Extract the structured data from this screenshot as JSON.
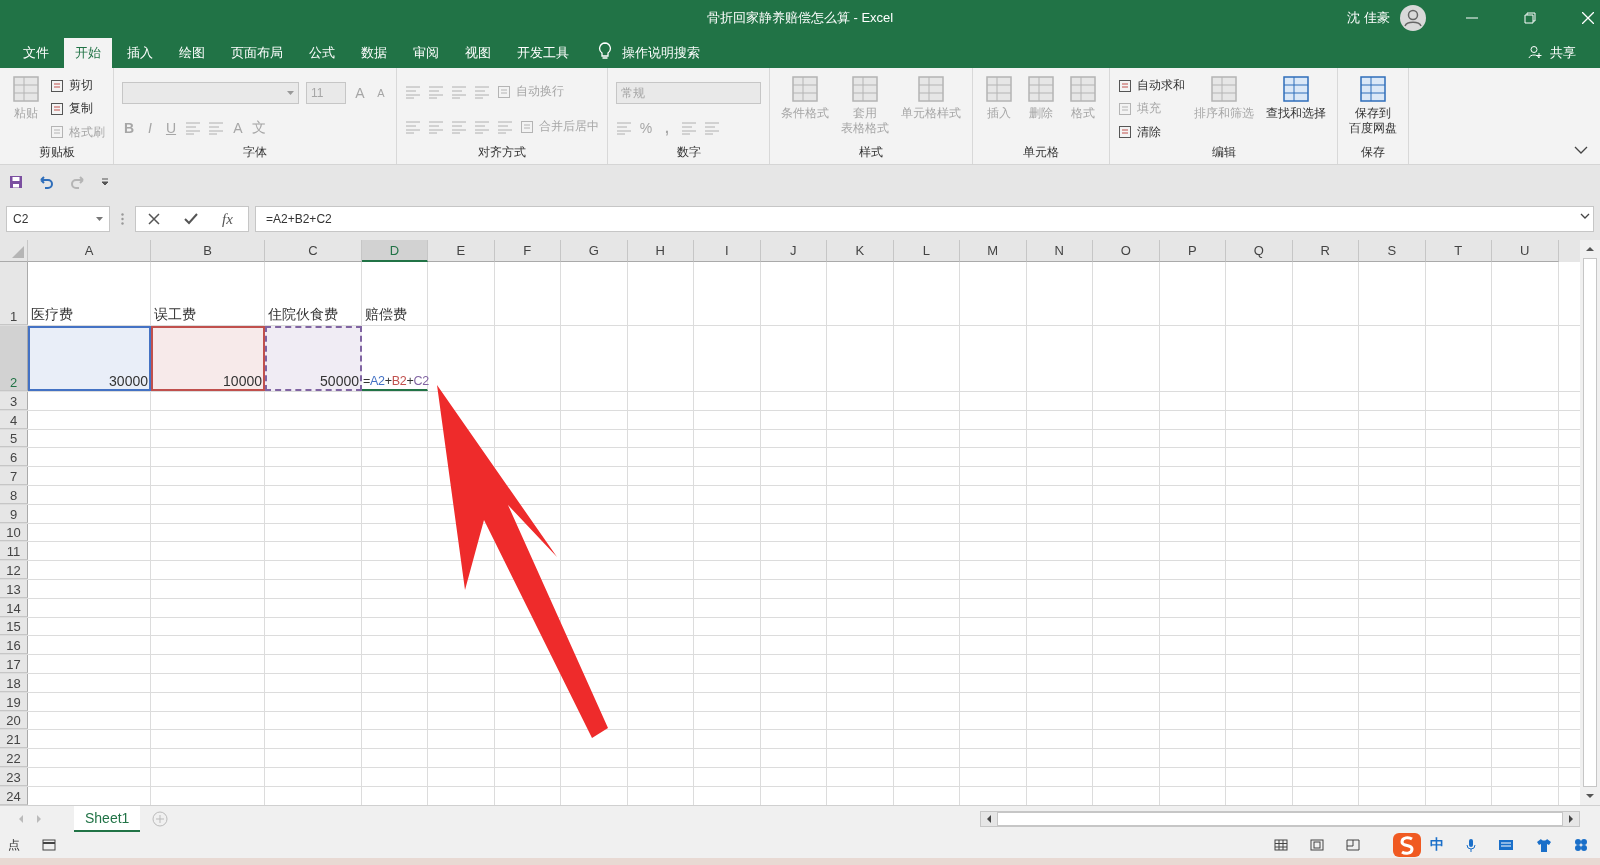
{
  "window": {
    "title": "骨折回家静养赔偿怎么算  -  Excel",
    "user": "沈 佳豪"
  },
  "menu": {
    "tabs": [
      {
        "label": "文件",
        "selected": false
      },
      {
        "label": "开始",
        "selected": true
      },
      {
        "label": "插入",
        "selected": false
      },
      {
        "label": "绘图",
        "selected": false
      },
      {
        "label": "页面布局",
        "selected": false
      },
      {
        "label": "公式",
        "selected": false
      },
      {
        "label": "数据",
        "selected": false
      },
      {
        "label": "审阅",
        "selected": false
      },
      {
        "label": "视图",
        "selected": false
      },
      {
        "label": "开发工具",
        "selected": false
      }
    ],
    "tell_me": "操作说明搜索",
    "share": "共享"
  },
  "ribbon": {
    "groups": [
      {
        "label": "剪贴板",
        "columns": [
          {
            "kind": "large",
            "lines": [
              "粘贴"
            ],
            "disabled": true
          },
          {
            "kind": "tools",
            "rows": [
              [
                {
                  "kind": "labeled",
                  "label": "剪切",
                  "disabled": false
                }
              ],
              [
                {
                  "kind": "labeled",
                  "label": "复制",
                  "disabled": false
                }
              ],
              [
                {
                  "kind": "labeled",
                  "label": "格式刷",
                  "disabled": true
                }
              ]
            ]
          }
        ]
      },
      {
        "label": "字体",
        "columns": [
          {
            "kind": "tools",
            "rows": [
              [
                {
                  "kind": "font-name",
                  "disabled": true
                },
                {
                  "kind": "font-size",
                  "text": "11",
                  "disabled": true
                },
                {
                  "kind": "glyph",
                  "text": "A",
                  "disabled": true
                },
                {
                  "kind": "small",
                  "text": "A",
                  "disabled": true
                }
              ],
              [
                {
                  "kind": "bold",
                  "text": "B",
                  "disabled": true
                },
                {
                  "kind": "italic",
                  "text": "I",
                  "disabled": true
                },
                {
                  "kind": "underline",
                  "text": "U",
                  "disabled": true
                },
                {
                  "kind": "icon",
                  "disabled": true
                },
                {
                  "kind": "icon",
                  "disabled": true
                },
                {
                  "kind": "glyph",
                  "text": "A",
                  "disabled": true
                },
                {
                  "kind": "glyph",
                  "text": "文",
                  "disabled": true
                }
              ]
            ]
          }
        ]
      },
      {
        "label": "对齐方式",
        "columns": [
          {
            "kind": "tools",
            "rows": [
              [
                {
                  "kind": "icon",
                  "disabled": true
                },
                {
                  "kind": "icon",
                  "disabled": true
                },
                {
                  "kind": "icon",
                  "disabled": true
                },
                {
                  "kind": "icon",
                  "disabled": true
                },
                {
                  "kind": "labeled",
                  "label": "自动换行",
                  "disabled": true
                }
              ],
              [
                {
                  "kind": "icon",
                  "disabled": true
                },
                {
                  "kind": "icon",
                  "disabled": true
                },
                {
                  "kind": "icon",
                  "disabled": true
                },
                {
                  "kind": "icon",
                  "disabled": true
                },
                {
                  "kind": "icon",
                  "disabled": true
                },
                {
                  "kind": "labeled",
                  "label": "合并后居中",
                  "disabled": true
                }
              ]
            ]
          }
        ]
      },
      {
        "label": "数字",
        "columns": [
          {
            "kind": "tools",
            "rows": [
              [
                {
                  "kind": "format",
                  "text": "常规",
                  "disabled": true
                }
              ],
              [
                {
                  "kind": "icon",
                  "disabled": true
                },
                {
                  "kind": "glyph",
                  "text": "%",
                  "disabled": true
                },
                {
                  "kind": "bold",
                  "text": ",",
                  "disabled": true
                },
                {
                  "kind": "icon",
                  "disabled": true
                },
                {
                  "kind": "icon",
                  "disabled": true
                }
              ]
            ]
          }
        ]
      },
      {
        "label": "样式",
        "columns": [
          {
            "kind": "large",
            "lines": [
              "条件格式"
            ],
            "disabled": true
          },
          {
            "kind": "large",
            "lines": [
              "套用",
              "表格格式"
            ],
            "disabled": true
          },
          {
            "kind": "large",
            "lines": [
              "单元格样式"
            ],
            "disabled": true
          }
        ]
      },
      {
        "label": "单元格",
        "columns": [
          {
            "kind": "large",
            "lines": [
              "插入"
            ],
            "disabled": true
          },
          {
            "kind": "large",
            "lines": [
              "删除"
            ],
            "disabled": true
          },
          {
            "kind": "large",
            "lines": [
              "格式"
            ],
            "disabled": true
          }
        ]
      },
      {
        "label": "编辑",
        "columns": [
          {
            "kind": "tools",
            "rows": [
              [
                {
                  "kind": "labeled",
                  "label": "自动求和",
                  "disabled": false
                }
              ],
              [
                {
                  "kind": "labeled",
                  "label": "填充",
                  "disabled": true
                }
              ],
              [
                {
                  "kind": "labeled",
                  "label": "清除",
                  "disabled": false
                }
              ]
            ]
          },
          {
            "kind": "large",
            "lines": [
              "排序和筛选"
            ],
            "disabled": true
          },
          {
            "kind": "large",
            "lines": [
              "查找和选择"
            ],
            "disabled": false
          }
        ]
      },
      {
        "label": "保存",
        "columns": [
          {
            "kind": "large",
            "lines": [
              "保存到",
              "百度网盘"
            ],
            "disabled": false
          }
        ]
      }
    ]
  },
  "formula_bar": {
    "name_box": "C2",
    "function_label": "fx",
    "formula": "=A2+B2+C2"
  },
  "sheet": {
    "columns": [
      {
        "label": "A",
        "selected": false
      },
      {
        "label": "B",
        "selected": false
      },
      {
        "label": "C",
        "selected": false
      },
      {
        "label": "D",
        "selected": true
      },
      {
        "label": "E",
        "selected": false
      },
      {
        "label": "F",
        "selected": false
      },
      {
        "label": "G",
        "selected": false
      },
      {
        "label": "H",
        "selected": false
      },
      {
        "label": "I",
        "selected": false
      },
      {
        "label": "J",
        "selected": false
      },
      {
        "label": "K",
        "selected": false
      },
      {
        "label": "L",
        "selected": false
      },
      {
        "label": "M",
        "selected": false
      },
      {
        "label": "N",
        "selected": false
      },
      {
        "label": "O",
        "selected": false
      },
      {
        "label": "P",
        "selected": false
      },
      {
        "label": "Q",
        "selected": false
      },
      {
        "label": "R",
        "selected": false
      },
      {
        "label": "S",
        "selected": false
      },
      {
        "label": "T",
        "selected": false
      },
      {
        "label": "U",
        "selected": false
      }
    ],
    "rows": [
      {
        "label": "1",
        "selected": false,
        "cells": [
          {
            "kind": "text",
            "text": "医疗费"
          },
          {
            "kind": "text",
            "text": "误工费"
          },
          {
            "kind": "text",
            "text": "住院伙食费"
          },
          {
            "kind": "text",
            "text": "赔偿费"
          }
        ]
      },
      {
        "label": "2",
        "selected": true,
        "cells": [
          {
            "kind": "number",
            "text": "30000",
            "color": "#4472c4",
            "dashed": false
          },
          {
            "kind": "number",
            "text": "10000",
            "color": "#c0504d",
            "dashed": false
          },
          {
            "kind": "number",
            "text": "50000",
            "color": "#8064a2",
            "dashed": true
          },
          {
            "kind": "formula",
            "active": true,
            "parts": [
              {
                "text": "="
              },
              {
                "text": "A2",
                "color": "#4472c4"
              },
              {
                "text": "+"
              },
              {
                "text": "B2",
                "color": "#c0504d"
              },
              {
                "text": "+"
              },
              {
                "text": "C2",
                "color": "#8064a2"
              }
            ]
          }
        ]
      },
      {
        "label": "3",
        "selected": false
      },
      {
        "label": "4",
        "selected": false
      },
      {
        "label": "5",
        "selected": false
      },
      {
        "label": "6",
        "selected": false
      },
      {
        "label": "7",
        "selected": false
      },
      {
        "label": "8",
        "selected": false
      },
      {
        "label": "9",
        "selected": false
      },
      {
        "label": "10",
        "selected": false
      },
      {
        "label": "11",
        "selected": false
      },
      {
        "label": "12",
        "selected": false
      },
      {
        "label": "13",
        "selected": false
      },
      {
        "label": "14",
        "selected": false
      },
      {
        "label": "15",
        "selected": false
      },
      {
        "label": "16",
        "selected": false
      },
      {
        "label": "17",
        "selected": false
      },
      {
        "label": "18",
        "selected": false
      },
      {
        "label": "19",
        "selected": false
      },
      {
        "label": "20",
        "selected": false
      },
      {
        "label": "21",
        "selected": false
      },
      {
        "label": "22",
        "selected": false
      },
      {
        "label": "23",
        "selected": false
      },
      {
        "label": "24",
        "selected": false
      }
    ]
  },
  "sheet_tabs": [
    {
      "label": "Sheet1",
      "selected": true
    }
  ],
  "status_bar": {
    "mode": "点",
    "ime": "中"
  }
}
